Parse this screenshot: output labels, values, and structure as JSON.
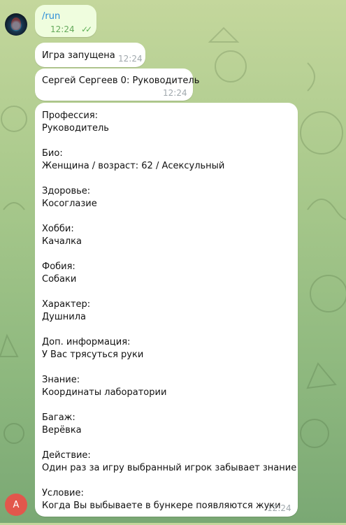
{
  "chat": {
    "messages": [
      {
        "text": "/run",
        "time": "12:24",
        "status": "read"
      },
      {
        "text": "Игра запущена",
        "time": "12:24"
      },
      {
        "text": "Сергей Сергеев 0: Руководитель",
        "time": "12:24"
      }
    ],
    "card": {
      "time": "12:24",
      "fields": [
        {
          "label": "Профессия:",
          "value": "Руководитель"
        },
        {
          "label": "Био:",
          "value": "Женщина / возраст: 62 / Асексульный"
        },
        {
          "label": "Здоровье:",
          "value": "Косоглазие"
        },
        {
          "label": "Хобби:",
          "value": "Качалка"
        },
        {
          "label": "Фобия:",
          "value": "Собаки"
        },
        {
          "label": "Характер:",
          "value": "Душнила"
        },
        {
          "label": "Доп. информация:",
          "value": "У Вас трясуться руки"
        },
        {
          "label": "Знание:",
          "value": "Координаты лаборатории"
        },
        {
          "label": "Багаж:",
          "value": "Верёвка"
        },
        {
          "label": "Действие:",
          "value": "Один раз за игру выбранный игрок забывает знание"
        },
        {
          "label": "Условие:",
          "value": "Когда Вы выбываете в бункере появляются жуки"
        }
      ]
    },
    "bot_avatar_letter": "A"
  },
  "colors": {
    "link": "#2a8dd8",
    "read_ticks": "#5fb157",
    "bot_avatar": "#e2574c",
    "outgoing": "#effdde"
  }
}
